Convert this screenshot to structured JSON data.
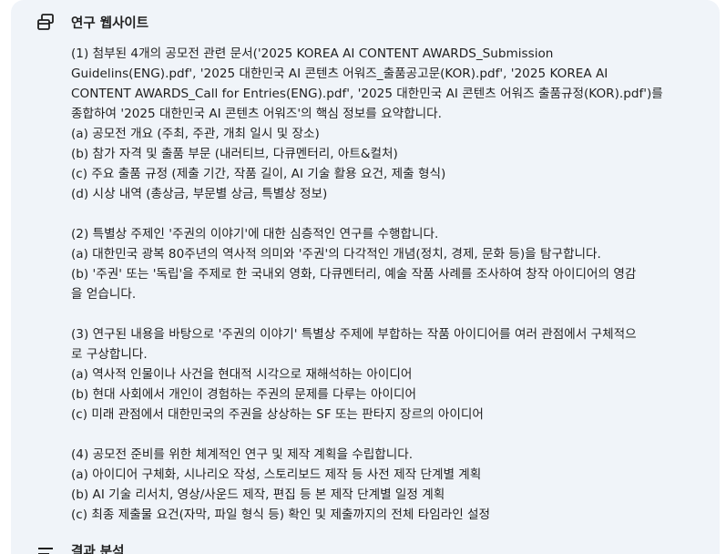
{
  "research_section": {
    "icon": "web-pages-icon",
    "title": "연구 웹사이트",
    "paragraphs": [
      {
        "lines": [
          "(1) 첨부된 4개의 공모전 관련 문서('2025 KOREA AI CONTENT AWARDS_Submission",
          "Guidelins(ENG).pdf', '2025 대한민국 AI 콘텐츠 어워즈_출품공고문(KOR).pdf', '2025 KOREA AI",
          "CONTENT AWARDS_Call for Entries(ENG).pdf', '2025 대한민국 AI 콘텐츠 어워즈 출품규정(KOR).pdf')를",
          "종합하여 '2025 대한민국 AI 콘텐츠 어워즈'의 핵심 정보를 요약합니다.",
          "(a) 공모전 개요 (주최, 주관, 개최 일시 및 장소)",
          "(b) 참가 자격 및 출품 부문 (내러티브, 다큐멘터리, 아트&컬처)",
          "(c) 주요 출품 규정 (제출 기간, 작품 길이, AI 기술 활용 요건, 제출 형식)",
          "(d) 시상 내역 (총상금, 부문별 상금, 특별상 정보)"
        ]
      },
      {
        "lines": [
          "(2) 특별상 주제인 '주권의 이야기'에 대한 심층적인 연구를 수행합니다.",
          "(a) 대한민국 광복 80주년의 역사적 의미와 '주권'의 다각적인 개념(정치, 경제, 문화 등)을 탐구합니다.",
          "(b) '주권' 또는 '독립'을 주제로 한 국내외 영화, 다큐멘터리, 예술 작품 사례를 조사하여 창작 아이디어의 영감",
          "을 얻습니다."
        ]
      },
      {
        "lines": [
          "(3) 연구된 내용을 바탕으로 '주권의 이야기' 특별상 주제에 부합하는 작품 아이디어를 여러 관점에서 구체적으",
          "로 구상합니다.",
          "(a) 역사적 인물이나 사건을 현대적 시각으로 재해석하는 아이디어",
          "(b) 현대 사회에서 개인이 경험하는 주권의 문제를 다루는 아이디어",
          "(c) 미래 관점에서 대한민국의 주권을 상상하는 SF 또는 판타지 장르의 아이디어"
        ]
      },
      {
        "lines": [
          "(4) 공모전 준비를 위한 체계적인 연구 및 제작 계획을 수립합니다.",
          "(a) 아이디어 구체화, 시나리오 작성, 스토리보드 제작 등 사전 제작 단계별 계획",
          "(b) AI 기술 리서치, 영상/사운드 제작, 편집 등 본 제작 단계별 일정 계획",
          "(c) 최종 제출물 요건(자막, 파일 형식 등) 확인 및 제출까지의 전체 타임라인 설정"
        ]
      }
    ]
  },
  "analysis_section": {
    "icon": "list-lines-icon",
    "title": "결과 분석"
  }
}
